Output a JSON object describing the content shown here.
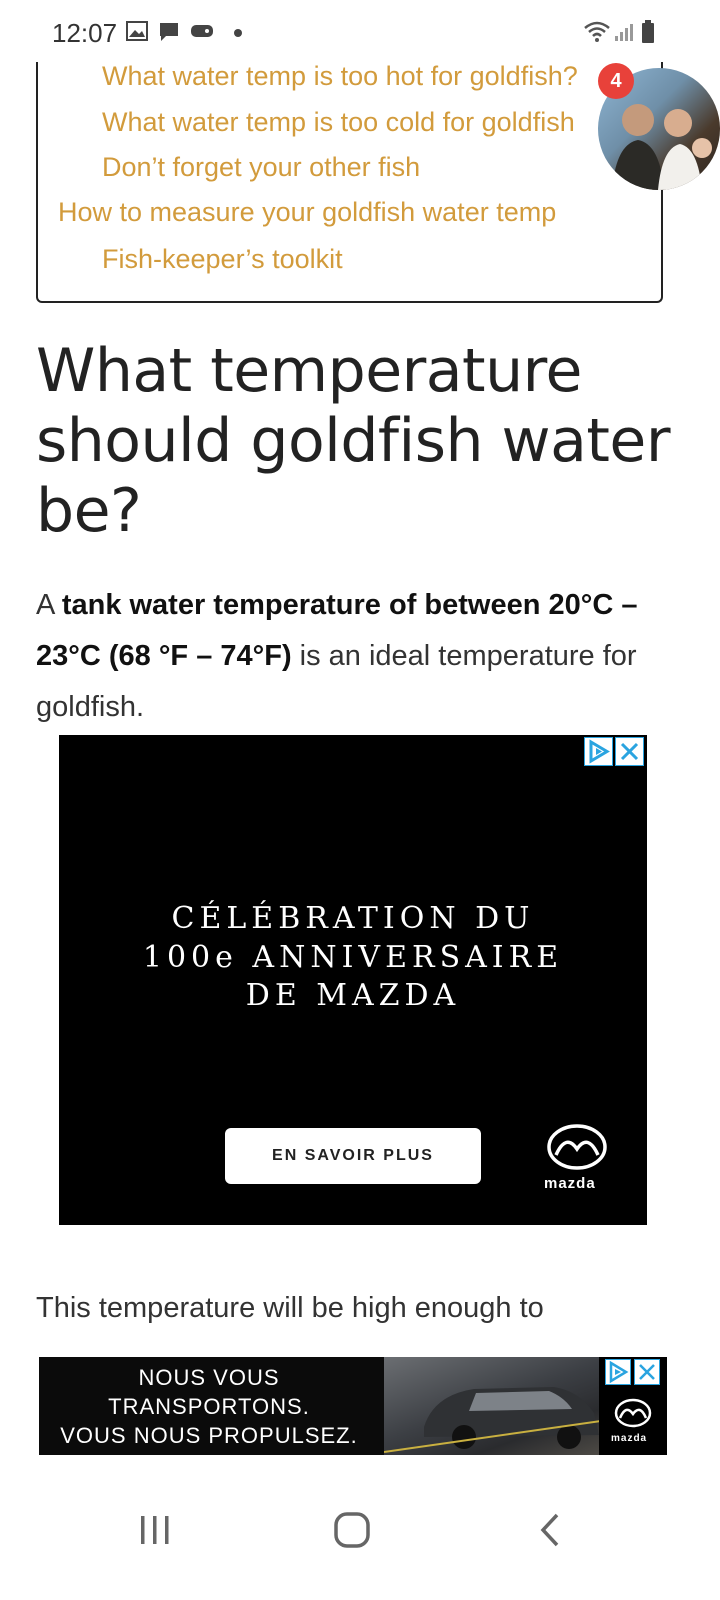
{
  "status_bar": {
    "time": "12:07",
    "icons": [
      "image-icon",
      "message-icon",
      "game-icon",
      "wifi-icon",
      "signal-icon",
      "battery-icon"
    ]
  },
  "toc": {
    "items": [
      {
        "label": "What water temp is too hot for goldfish?",
        "level": 2
      },
      {
        "label": "What water temp is too cold for goldfish",
        "level": 2
      },
      {
        "label": "Don’t forget your other fish",
        "level": 2
      },
      {
        "label": "How to measure your goldfish water temp",
        "level": 1
      },
      {
        "label": "Fish-keeper’s toolkit",
        "level": 2
      }
    ],
    "link_color": "#d29b3c"
  },
  "chat_head": {
    "badge_count": "4"
  },
  "article": {
    "heading": "What temperature should goldfish water be?",
    "para1": {
      "prefix": "A ",
      "bold": "tank water temperature of between 20°C – 23°C (68 °F – 74°F)",
      "suffix": " is an ideal temperature for goldfish."
    },
    "para2": "This temperature will be high enough to"
  },
  "ad_big": {
    "title_lines": [
      "CÉLÉBRATION DU",
      "100e ANNIVERSAIRE",
      "DE MAZDA"
    ],
    "cta": "EN SAVOIR PLUS",
    "brand": "mazda"
  },
  "ad_small": {
    "lines": [
      "NOUS VOUS",
      "TRANSPORTONS.",
      "VOUS NOUS PROPULSEZ."
    ],
    "brand": "mazda"
  },
  "navbar": {
    "buttons": [
      "recent-apps",
      "home",
      "back"
    ]
  }
}
